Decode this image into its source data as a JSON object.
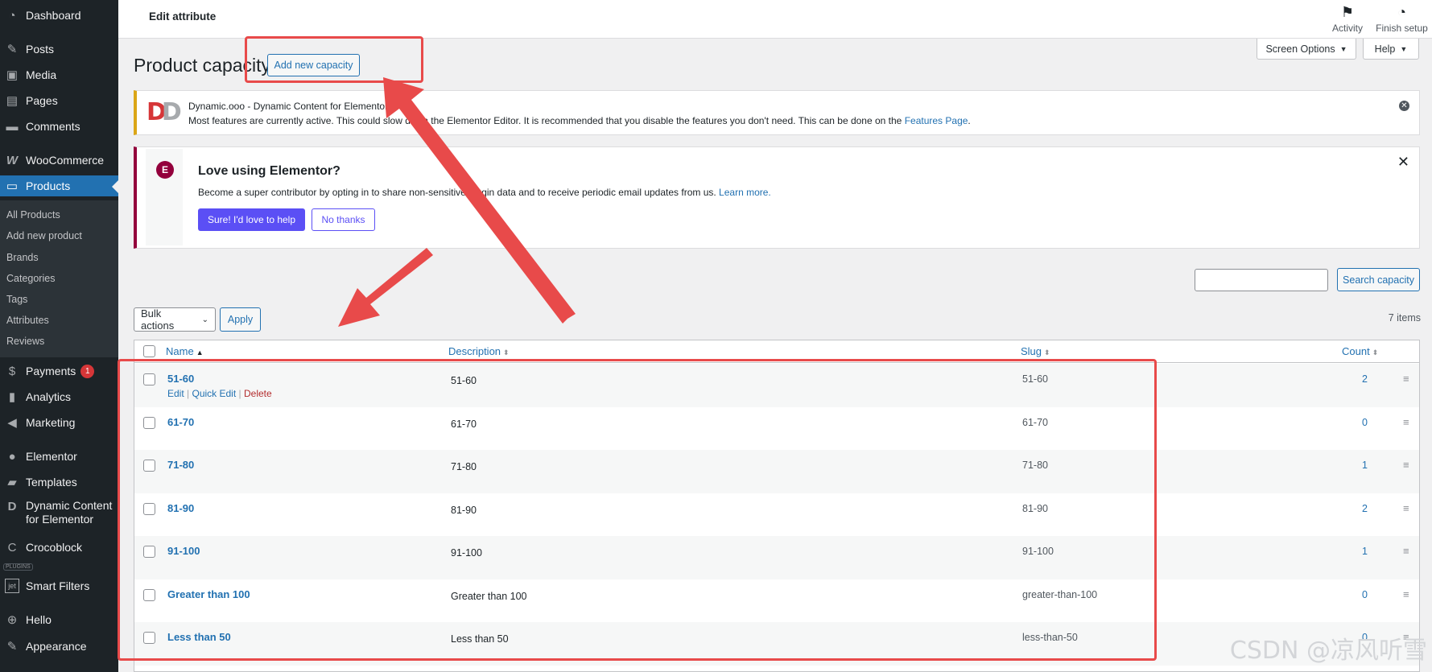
{
  "sidebar": {
    "items": [
      {
        "label": "Dashboard",
        "icon": "dashboard-icon"
      },
      {
        "label": "Posts",
        "icon": "pin-icon"
      },
      {
        "label": "Media",
        "icon": "media-icon"
      },
      {
        "label": "Pages",
        "icon": "pages-icon"
      },
      {
        "label": "Comments",
        "icon": "comment-icon"
      },
      {
        "label": "WooCommerce",
        "icon": "woocommerce-icon"
      },
      {
        "label": "Products",
        "icon": "archive-icon"
      },
      {
        "label": "Payments",
        "icon": "payments-icon",
        "badge": "1"
      },
      {
        "label": "Analytics",
        "icon": "chart-icon"
      },
      {
        "label": "Marketing",
        "icon": "megaphone-icon"
      },
      {
        "label": "Elementor",
        "icon": "elementor-icon"
      },
      {
        "label": "Templates",
        "icon": "folder-icon"
      },
      {
        "label": "Dynamic Content",
        "label2": "for Elementor",
        "icon": "dynamic-icon"
      },
      {
        "label": "Crocoblock",
        "icon": "crocoblock-icon"
      },
      {
        "label": "Smart Filters",
        "icon": "jet-icon"
      },
      {
        "label": "Hello",
        "icon": "plus-circle-icon"
      },
      {
        "label": "Appearance",
        "icon": "brush-icon"
      }
    ],
    "submenu": [
      "All Products",
      "Add new product",
      "Brands",
      "Categories",
      "Tags",
      "Attributes",
      "Reviews"
    ],
    "plugins_tag": "PLUGINS"
  },
  "topbar": {
    "title": "Edit attribute",
    "activity_label": "Activity",
    "finish_setup_label": "Finish setup",
    "screen_options_label": "Screen Options",
    "help_label": "Help"
  },
  "page": {
    "title": "Product capacity",
    "add_new_label": "Add new capacity"
  },
  "notice_dynamic": {
    "title": "Dynamic.ooo - Dynamic Content for Elementor",
    "message": "Most features are currently active. This could slow down the Elementor Editor. It is recommended that you disable the features you don't need. This can be done on the",
    "link": "Features Page",
    "end": "."
  },
  "notice_elementor": {
    "heading": "Love using Elementor?",
    "message": "Become a super contributor by opting in to share non-sensitive plugin data and to receive periodic email updates from us.",
    "link": "Learn more.",
    "accept_label": "Sure! I'd love to help",
    "decline_label": "No thanks"
  },
  "search": {
    "button_label": "Search capacity",
    "value": ""
  },
  "bulk": {
    "select_label": "Bulk actions",
    "apply_label": "Apply",
    "items_count": "7 items"
  },
  "table": {
    "columns": {
      "name": "Name",
      "description": "Description",
      "slug": "Slug",
      "count": "Count"
    },
    "row_actions": {
      "edit": "Edit",
      "quick_edit": "Quick Edit",
      "delete": "Delete"
    },
    "rows": [
      {
        "name": "51-60",
        "description": "51-60",
        "slug": "51-60",
        "count": "2"
      },
      {
        "name": "61-70",
        "description": "61-70",
        "slug": "61-70",
        "count": "0"
      },
      {
        "name": "71-80",
        "description": "71-80",
        "slug": "71-80",
        "count": "1"
      },
      {
        "name": "81-90",
        "description": "81-90",
        "slug": "81-90",
        "count": "2"
      },
      {
        "name": "91-100",
        "description": "91-100",
        "slug": "91-100",
        "count": "1"
      },
      {
        "name": "Greater than 100",
        "description": "Greater than 100",
        "slug": "greater-than-100",
        "count": "0"
      },
      {
        "name": "Less than 50",
        "description": "Less than 50",
        "slug": "less-than-50",
        "count": "0"
      }
    ]
  },
  "watermark": "CSDN @凉风听雪",
  "colors": {
    "sidebar_bg": "#1d2327",
    "accent_blue": "#2271b1",
    "annotation_red": "#e84a4a",
    "elementor_purple": "#5b4ff5"
  }
}
